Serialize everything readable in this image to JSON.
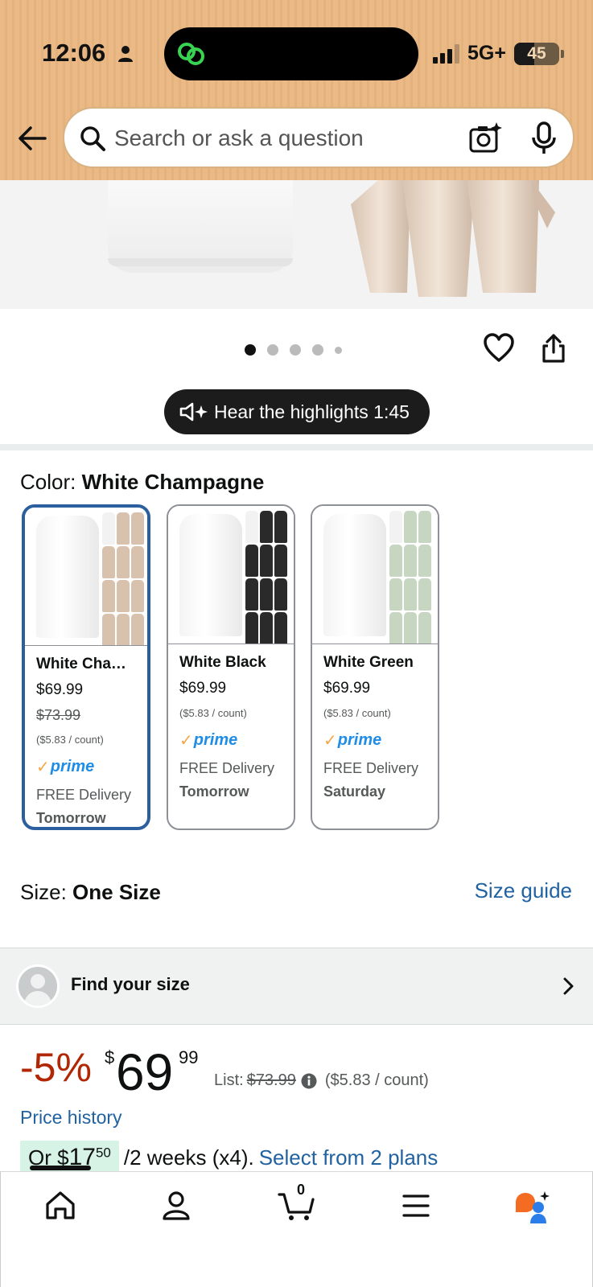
{
  "status_bar": {
    "time": "12:06",
    "network": "5G+",
    "battery": "45",
    "battery_level": 0.45
  },
  "search": {
    "placeholder": "Search or ask a question"
  },
  "carousel": {
    "total_dots": 5,
    "active_index": 0
  },
  "audio": {
    "label": "Hear the highlights 1:45"
  },
  "color": {
    "label": "Color: ",
    "selected": "White Champagne"
  },
  "variants": [
    {
      "title": "White Champ...",
      "price": "$69.99",
      "list_price": "$73.99",
      "unit": "($5.83 / count)",
      "prime": "prime",
      "delivery": "FREE Delivery",
      "when": "Tomorrow",
      "accent": "#d9c2ad"
    },
    {
      "title": "White Black",
      "price": "$69.99",
      "unit": "($5.83 / count)",
      "prime": "prime",
      "delivery": "FREE Delivery",
      "when": "Tomorrow",
      "accent": "#2a2a2a"
    },
    {
      "title": "White Green",
      "price": "$69.99",
      "unit": "($5.83 / count)",
      "prime": "prime",
      "delivery": "FREE Delivery",
      "when": "Saturday",
      "accent": "#c6d6c1"
    }
  ],
  "size": {
    "label": "Size: ",
    "selected": "One Size",
    "guide": "Size guide"
  },
  "find_size": {
    "label": "Find your size"
  },
  "pricing": {
    "discount": "-5%",
    "currency": "$",
    "whole": "69",
    "fraction": "99",
    "list_label": "List:",
    "list_price": "$73.99",
    "unit": "($5.83 / count)",
    "history": "Price history"
  },
  "installments": {
    "prefix": "Or $",
    "amount": "17",
    "cents": "50",
    "period": "/2 weeks (x4).",
    "link": "Select from 2 plans"
  },
  "tabbar": {
    "cart_count": "0"
  },
  "colors": {
    "accent_blue": "#2162a1",
    "selected_border": "#2c5f9e",
    "deal_red": "#b12704",
    "prime_blue": "#1f8ce6",
    "header": "#eab985"
  }
}
